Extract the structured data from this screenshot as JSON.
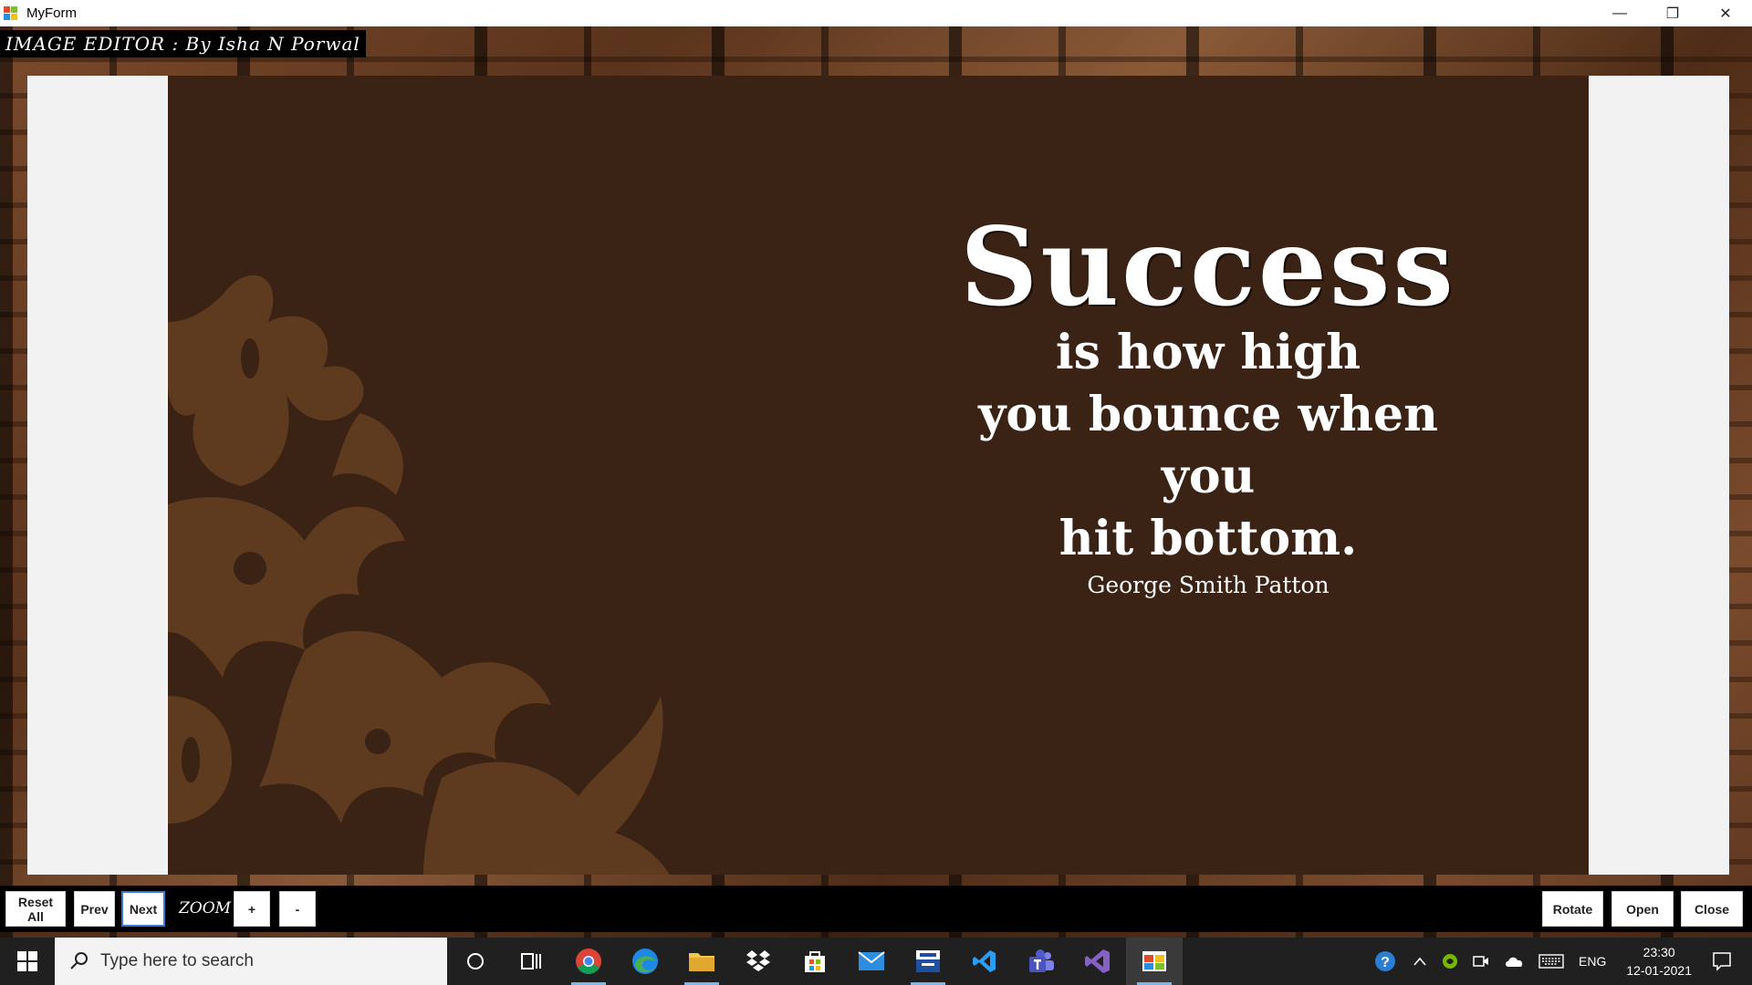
{
  "window": {
    "title": "MyForm",
    "controls": [
      "—",
      "❐",
      "✕"
    ]
  },
  "header": {
    "label": "IMAGE EDITOR : By Isha N Porwal"
  },
  "image": {
    "headline": "Success",
    "lines": [
      "is how high",
      "you bounce when you",
      "hit bottom."
    ],
    "author": "George Smith Patton"
  },
  "toolbar": {
    "reset_label_1": "Reset",
    "reset_label_2": "All",
    "prev_label": "Prev",
    "next_label": "Next",
    "zoom_label": "ZOOM",
    "zoom_in_label": "+",
    "zoom_out_label": "-",
    "rotate_label": "Rotate",
    "open_label": "Open",
    "close_label": "Close"
  },
  "taskbar": {
    "search_placeholder": "Type here to search",
    "apps": [
      "cortana-icon",
      "task-view-icon",
      "chrome-icon",
      "edge-icon",
      "file-explorer-icon",
      "dropbox-icon",
      "store-icon",
      "mail-icon",
      "dev-cpp-icon",
      "vscode-icon",
      "teams-icon",
      "visual-studio-icon",
      "myform-app-icon"
    ],
    "language": "ENG",
    "time": "23:30",
    "date": "12-01-2021"
  },
  "colors": {
    "image_bg": "#3a2214",
    "ornament": "#5e3a1e",
    "accent": "#76b9ed"
  }
}
